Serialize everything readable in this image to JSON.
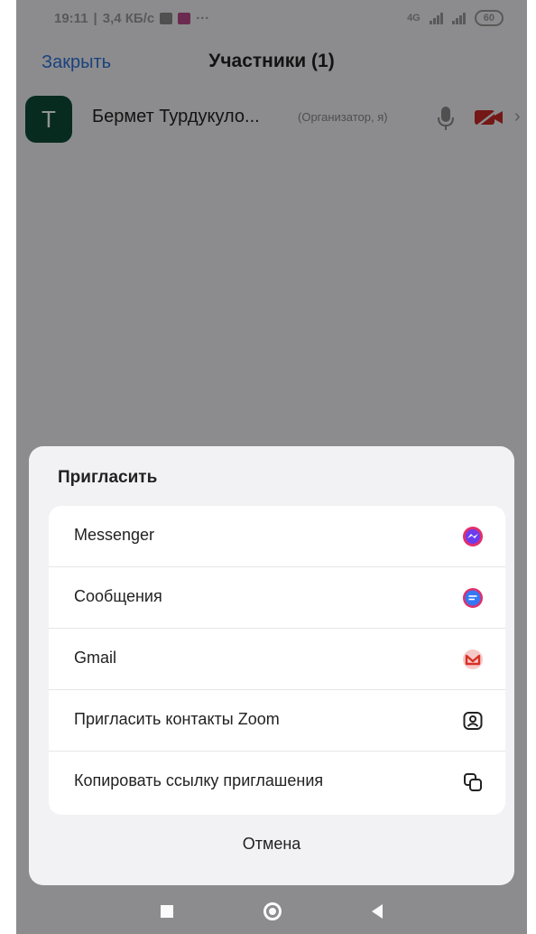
{
  "status_bar": {
    "time": "19:11",
    "speed": "3,4 КБ/с",
    "more": "···",
    "network": "4G",
    "battery": "60"
  },
  "header": {
    "close_label": "Закрыть",
    "title": "Участники (1)"
  },
  "participant": {
    "initial": "T",
    "name": "Бермет Турдукуло...",
    "role": "(Организатор, я)",
    "avatar_color": "#0e4a38"
  },
  "invite_sheet": {
    "title": "Пригласить",
    "options": [
      {
        "label": "Messenger",
        "icon": "messenger-icon",
        "color": "#8c3bf0"
      },
      {
        "label": "Сообщения",
        "icon": "messages-icon",
        "color": "#3478f6"
      },
      {
        "label": "Gmail",
        "icon": "gmail-icon",
        "color": "#d93025"
      },
      {
        "label": "Пригласить контакты Zoom",
        "icon": "contacts-icon",
        "color": "#222222"
      },
      {
        "label": "Копировать ссылку приглашения",
        "icon": "copy-link-icon",
        "color": "#222222"
      }
    ],
    "cancel_label": "Отмена"
  },
  "colors": {
    "accent": "#2d72d9",
    "muted_red": "#c62828"
  }
}
